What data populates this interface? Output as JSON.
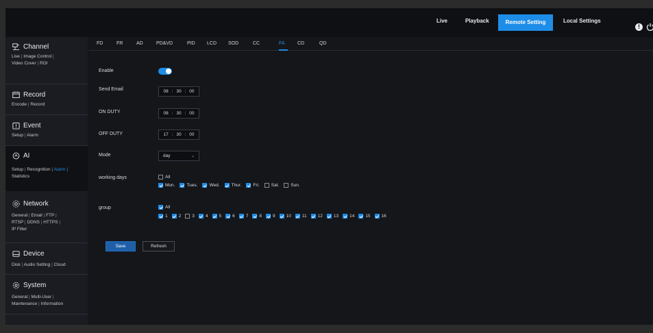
{
  "topnav": {
    "items": [
      {
        "label": "Live"
      },
      {
        "label": "Playback"
      },
      {
        "label": "Remote Setting"
      },
      {
        "label": "Local Settings"
      }
    ],
    "active_index": 2,
    "info_icon": "!",
    "icons": [
      "info-icon",
      "power-icon"
    ]
  },
  "sidebar": {
    "sections": [
      {
        "title": "Channel",
        "icon": "channel-icon",
        "links": [
          "Live",
          "Image Control",
          "Video Cover",
          "ROI"
        ]
      },
      {
        "title": "Record",
        "icon": "record-icon",
        "links": [
          "Encode",
          "Record"
        ]
      },
      {
        "title": "Event",
        "icon": "event-icon",
        "links": [
          "Setup",
          "Alarm"
        ]
      },
      {
        "title": "AI",
        "icon": "ai-icon",
        "links": [
          "Setup",
          "Recognition",
          "Alarm",
          "Statistics"
        ],
        "active_link": "Alarm"
      },
      {
        "title": "Network",
        "icon": "network-icon",
        "links": [
          "General",
          "Email",
          "FTP",
          "RTSP",
          "DDNS",
          "HTTPS",
          "IP Filter"
        ]
      },
      {
        "title": "Device",
        "icon": "device-icon",
        "links": [
          "Disk",
          "Audio Setting",
          "Cloud"
        ]
      },
      {
        "title": "System",
        "icon": "system-icon",
        "links": [
          "General",
          "Multi-User",
          "Maintenance",
          "Information"
        ]
      }
    ],
    "separator": "|"
  },
  "tabs": {
    "items": [
      "FD",
      "FR",
      "AD",
      "PD&VD",
      "PID",
      "LCD",
      "SOD",
      "CC",
      "FA",
      "CD",
      "QD"
    ],
    "active": "FA"
  },
  "form": {
    "enable_label": "Enable",
    "enable_value": true,
    "send_email": {
      "label": "Send Email",
      "h": "08",
      "m": "30",
      "s": "00"
    },
    "on_duty": {
      "label": "ON DUTY",
      "h": "08",
      "m": "30",
      "s": "00"
    },
    "off_duty": {
      "label": "OFF DUTY",
      "h": "17",
      "m": "30",
      "s": "00"
    },
    "time_sep": ":",
    "mode": {
      "label": "Mode",
      "value": "day",
      "chevron": "⌄"
    },
    "working_days": {
      "label": "working days",
      "all_label": "All",
      "all_checked": false,
      "days": [
        {
          "label": "Mon.",
          "checked": true
        },
        {
          "label": "Tues.",
          "checked": true
        },
        {
          "label": "Wed.",
          "checked": true
        },
        {
          "label": "Thur.",
          "checked": true
        },
        {
          "label": "Fri.",
          "checked": true
        },
        {
          "label": "Sat.",
          "checked": false
        },
        {
          "label": "Sun.",
          "checked": false
        }
      ]
    },
    "group": {
      "label": "group",
      "all_label": "All",
      "all_checked": true,
      "items": [
        {
          "label": "1",
          "checked": true
        },
        {
          "label": "2",
          "checked": true
        },
        {
          "label": "3",
          "checked": false
        },
        {
          "label": "4",
          "checked": true
        },
        {
          "label": "5",
          "checked": true
        },
        {
          "label": "6",
          "checked": true
        },
        {
          "label": "7",
          "checked": true
        },
        {
          "label": "8",
          "checked": true
        },
        {
          "label": "9",
          "checked": true
        },
        {
          "label": "10",
          "checked": true
        },
        {
          "label": "11",
          "checked": true
        },
        {
          "label": "12",
          "checked": true
        },
        {
          "label": "13",
          "checked": true
        },
        {
          "label": "14",
          "checked": true
        },
        {
          "label": "15",
          "checked": true
        },
        {
          "label": "16",
          "checked": true
        }
      ]
    },
    "save_label": "Save",
    "refresh_label": "Refresh"
  },
  "colors": {
    "accent": "#1e8de8",
    "background": "#14161a",
    "sidebar": "#1a1c21"
  }
}
